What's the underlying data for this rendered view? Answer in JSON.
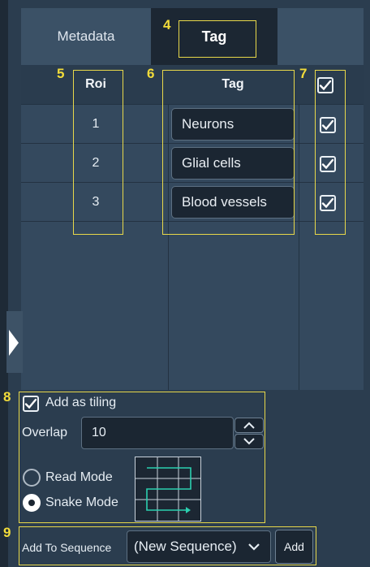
{
  "tabs": [
    {
      "label": "Metadata"
    },
    {
      "label": "Tag"
    }
  ],
  "table": {
    "headers": {
      "roi": "Roi",
      "tag": "Tag"
    },
    "rows": [
      {
        "roi": "1",
        "tag": "Neurons",
        "checked": true
      },
      {
        "roi": "2",
        "tag": "Glial cells",
        "checked": true
      },
      {
        "roi": "3",
        "tag": "Blood vessels",
        "checked": true
      }
    ],
    "header_checked": true
  },
  "annotations": {
    "n4": "4",
    "n5": "5",
    "n6": "6",
    "n7": "7",
    "n8": "8",
    "n9": "9"
  },
  "tiling": {
    "add_as_tiling_label": "Add as tiling",
    "add_as_tiling_checked": true,
    "overlap_label": "Overlap",
    "overlap_value": "10",
    "read_mode_label": "Read Mode",
    "snake_mode_label": "Snake Mode",
    "selected_mode": "Snake Mode"
  },
  "sequence": {
    "label": "Add To Sequence",
    "selected": "(New Sequence)",
    "add_button": "Add"
  },
  "colors": {
    "annotation": "#e8d84a",
    "accent": "#2bd0b0"
  }
}
